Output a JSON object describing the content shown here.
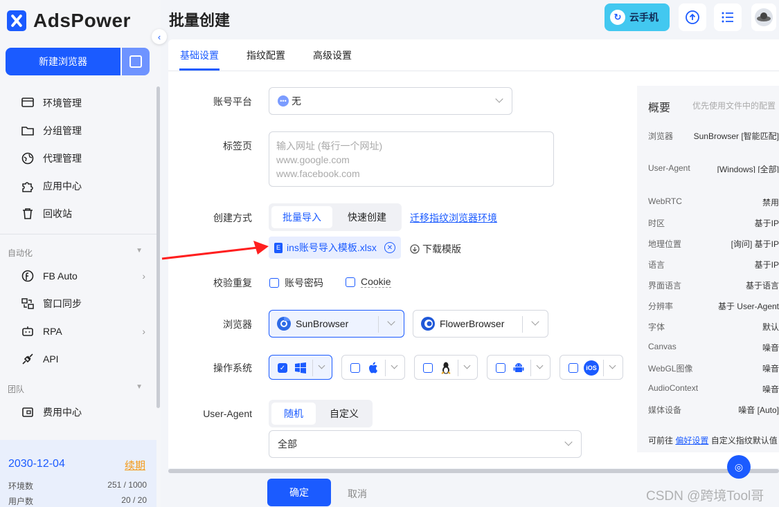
{
  "app": {
    "name": "AdsPower"
  },
  "sidebar": {
    "new_browser_label": "新建浏览器",
    "items": [
      {
        "label": "环境管理",
        "icon": "monitor-icon"
      },
      {
        "label": "分组管理",
        "icon": "folder-icon"
      },
      {
        "label": "代理管理",
        "icon": "globe-icon"
      },
      {
        "label": "应用中心",
        "icon": "puzzle-icon"
      },
      {
        "label": "回收站",
        "icon": "trash-icon"
      }
    ],
    "section_automation": "自动化",
    "automation_items": [
      {
        "label": "FB Auto",
        "icon": "facebook-icon"
      },
      {
        "label": "窗口同步",
        "icon": "sync-icon"
      },
      {
        "label": "RPA",
        "icon": "robot-icon"
      },
      {
        "label": "API",
        "icon": "plug-icon"
      }
    ],
    "section_team": "团队",
    "team_items": [
      {
        "label": "费用中心",
        "icon": "wallet-icon"
      }
    ],
    "plan": {
      "date": "2030-12-04",
      "renew_label": "续期",
      "env_label": "环境数",
      "env_value": "251 / 1000",
      "user_label": "用户数",
      "user_value": "20 / 20"
    }
  },
  "header": {
    "title": "批量创建",
    "cloud_phone_label": "云手机"
  },
  "tabs": [
    {
      "label": "基础设置",
      "active": true
    },
    {
      "label": "指纹配置",
      "active": false
    },
    {
      "label": "高级设置",
      "active": false
    }
  ],
  "form": {
    "account_platform": {
      "label": "账号平台",
      "value": "无"
    },
    "tab_pages": {
      "label": "标签页",
      "placeholder_lines": [
        "输入网址 (每行一个网址)",
        "www.google.com",
        "www.facebook.com"
      ]
    },
    "create_method": {
      "label": "创建方式",
      "options": [
        "批量导入",
        "快速创建"
      ],
      "selected": "批量导入",
      "migrate_link": "迁移指纹浏览器环境",
      "file_name": "ins账号导入模板.xlsx",
      "download_label": "下载模版"
    },
    "dedupe": {
      "label": "校验重复",
      "options": [
        "账号密码",
        "Cookie"
      ]
    },
    "browser": {
      "label": "浏览器",
      "options": [
        "SunBrowser",
        "FlowerBrowser"
      ],
      "selected": "SunBrowser"
    },
    "os": {
      "label": "操作系统",
      "options": [
        {
          "icon": "windows-icon",
          "checked": true
        },
        {
          "icon": "apple-icon",
          "checked": false
        },
        {
          "icon": "linux-icon",
          "checked": false
        },
        {
          "icon": "android-icon",
          "checked": false
        },
        {
          "icon": "ios-icon",
          "checked": false,
          "text": "iOS"
        }
      ]
    },
    "user_agent": {
      "label": "User-Agent",
      "options": [
        "随机",
        "自定义"
      ],
      "selected": "随机",
      "value": "全部"
    }
  },
  "summary": {
    "title": "概要",
    "hint": "优先使用文件中的配置",
    "rows": [
      {
        "k": "浏览器",
        "v": "SunBrowser [智能匹配]"
      },
      {
        "k": "User-Agent",
        "v": "[Windows] [全部]"
      },
      {
        "k": "WebRTC",
        "v": "禁用"
      },
      {
        "k": "时区",
        "v": "基于IP"
      },
      {
        "k": "地理位置",
        "v": "[询问] 基于IP"
      },
      {
        "k": "语言",
        "v": "基于IP"
      },
      {
        "k": "界面语言",
        "v": "基于语言"
      },
      {
        "k": "分辨率",
        "v": "基于 User-Agent"
      },
      {
        "k": "字体",
        "v": "默认"
      },
      {
        "k": "Canvas",
        "v": "噪音"
      },
      {
        "k": "WebGL图像",
        "v": "噪音"
      },
      {
        "k": "AudioContext",
        "v": "噪音"
      },
      {
        "k": "媒体设备",
        "v": "噪音 [Auto]"
      }
    ],
    "footer_prefix": "可前往",
    "footer_link": "偏好设置",
    "footer_suffix": "自定义指纹默认值"
  },
  "actions": {
    "ok": "确定",
    "cancel": "取消"
  },
  "watermark": "CSDN @跨境Tool哥",
  "colors": {
    "primary": "#1b5bff",
    "accent_orange": "#f39a18",
    "cloud": "#42c8f0"
  }
}
